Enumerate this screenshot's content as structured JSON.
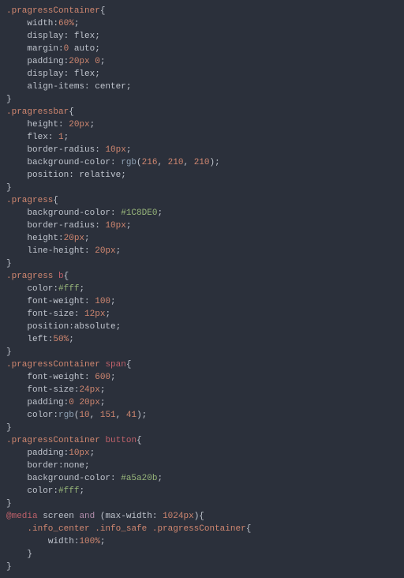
{
  "code": {
    "lines": [
      [
        {
          "t": ".pragressContainer",
          "c": "sel"
        },
        {
          "t": "{",
          "c": "punc"
        }
      ],
      [
        {
          "t": "    ",
          "c": ""
        },
        {
          "t": "width",
          "c": "prop"
        },
        {
          "t": ":",
          "c": "punc"
        },
        {
          "t": "60%",
          "c": "num"
        },
        {
          "t": ";",
          "c": "punc"
        }
      ],
      [
        {
          "t": "    ",
          "c": ""
        },
        {
          "t": "display",
          "c": "prop"
        },
        {
          "t": ": ",
          "c": "punc"
        },
        {
          "t": "flex",
          "c": "prop"
        },
        {
          "t": ";",
          "c": "punc"
        }
      ],
      [
        {
          "t": "    ",
          "c": ""
        },
        {
          "t": "margin",
          "c": "prop"
        },
        {
          "t": ":",
          "c": "punc"
        },
        {
          "t": "0",
          "c": "num"
        },
        {
          "t": " ",
          "c": ""
        },
        {
          "t": "auto",
          "c": "prop"
        },
        {
          "t": ";",
          "c": "punc"
        }
      ],
      [
        {
          "t": "    ",
          "c": ""
        },
        {
          "t": "padding",
          "c": "prop"
        },
        {
          "t": ":",
          "c": "punc"
        },
        {
          "t": "20px",
          "c": "num"
        },
        {
          "t": " ",
          "c": ""
        },
        {
          "t": "0",
          "c": "num"
        },
        {
          "t": ";",
          "c": "punc"
        }
      ],
      [
        {
          "t": "    ",
          "c": ""
        },
        {
          "t": "display",
          "c": "prop"
        },
        {
          "t": ": ",
          "c": "punc"
        },
        {
          "t": "flex",
          "c": "prop"
        },
        {
          "t": ";",
          "c": "punc"
        }
      ],
      [
        {
          "t": "    ",
          "c": ""
        },
        {
          "t": "align-items",
          "c": "prop"
        },
        {
          "t": ": ",
          "c": "punc"
        },
        {
          "t": "center",
          "c": "prop"
        },
        {
          "t": ";",
          "c": "punc"
        }
      ],
      [
        {
          "t": "}",
          "c": "punc"
        }
      ],
      [
        {
          "t": ".pragressbar",
          "c": "sel"
        },
        {
          "t": "{",
          "c": "punc"
        }
      ],
      [
        {
          "t": "    ",
          "c": ""
        },
        {
          "t": "height",
          "c": "prop"
        },
        {
          "t": ": ",
          "c": "punc"
        },
        {
          "t": "20px",
          "c": "num"
        },
        {
          "t": ";",
          "c": "punc"
        }
      ],
      [
        {
          "t": "    ",
          "c": ""
        },
        {
          "t": "flex",
          "c": "prop"
        },
        {
          "t": ": ",
          "c": "punc"
        },
        {
          "t": "1",
          "c": "num"
        },
        {
          "t": ";",
          "c": "punc"
        }
      ],
      [
        {
          "t": "    ",
          "c": ""
        },
        {
          "t": "border-radius",
          "c": "prop"
        },
        {
          "t": ": ",
          "c": "punc"
        },
        {
          "t": "10px",
          "c": "num"
        },
        {
          "t": ";",
          "c": "punc"
        }
      ],
      [
        {
          "t": "    ",
          "c": ""
        },
        {
          "t": "background-color",
          "c": "prop"
        },
        {
          "t": ": ",
          "c": "punc"
        },
        {
          "t": "rgb",
          "c": "fn"
        },
        {
          "t": "(",
          "c": "punc"
        },
        {
          "t": "216",
          "c": "num"
        },
        {
          "t": ", ",
          "c": "punc"
        },
        {
          "t": "210",
          "c": "num"
        },
        {
          "t": ", ",
          "c": "punc"
        },
        {
          "t": "210",
          "c": "num"
        },
        {
          "t": ");",
          "c": "punc"
        }
      ],
      [
        {
          "t": "    ",
          "c": ""
        },
        {
          "t": "position",
          "c": "prop"
        },
        {
          "t": ": ",
          "c": "punc"
        },
        {
          "t": "relative",
          "c": "prop"
        },
        {
          "t": ";",
          "c": "punc"
        }
      ],
      [
        {
          "t": "}",
          "c": "punc"
        }
      ],
      [
        {
          "t": ".pragress",
          "c": "sel"
        },
        {
          "t": "{",
          "c": "punc"
        }
      ],
      [
        {
          "t": "    ",
          "c": ""
        },
        {
          "t": "background-color",
          "c": "prop"
        },
        {
          "t": ": ",
          "c": "punc"
        },
        {
          "t": "#1C8DE0",
          "c": "hex"
        },
        {
          "t": ";",
          "c": "punc"
        }
      ],
      [
        {
          "t": "    ",
          "c": ""
        },
        {
          "t": "border-radius",
          "c": "prop"
        },
        {
          "t": ": ",
          "c": "punc"
        },
        {
          "t": "10px",
          "c": "num"
        },
        {
          "t": ";",
          "c": "punc"
        }
      ],
      [
        {
          "t": "    ",
          "c": ""
        },
        {
          "t": "height",
          "c": "prop"
        },
        {
          "t": ":",
          "c": "punc"
        },
        {
          "t": "20px",
          "c": "num"
        },
        {
          "t": ";",
          "c": "punc"
        }
      ],
      [
        {
          "t": "    ",
          "c": ""
        },
        {
          "t": "line-height",
          "c": "prop"
        },
        {
          "t": ": ",
          "c": "punc"
        },
        {
          "t": "20px",
          "c": "num"
        },
        {
          "t": ";",
          "c": "punc"
        }
      ],
      [
        {
          "t": "}",
          "c": "punc"
        }
      ],
      [
        {
          "t": ".pragress",
          "c": "sel"
        },
        {
          "t": " ",
          "c": ""
        },
        {
          "t": "b",
          "c": "tag"
        },
        {
          "t": "{",
          "c": "punc"
        }
      ],
      [
        {
          "t": "    ",
          "c": ""
        },
        {
          "t": "color",
          "c": "prop"
        },
        {
          "t": ":",
          "c": "punc"
        },
        {
          "t": "#fff",
          "c": "hex"
        },
        {
          "t": ";",
          "c": "punc"
        }
      ],
      [
        {
          "t": "    ",
          "c": ""
        },
        {
          "t": "font-weight",
          "c": "prop"
        },
        {
          "t": ": ",
          "c": "punc"
        },
        {
          "t": "100",
          "c": "num"
        },
        {
          "t": ";",
          "c": "punc"
        }
      ],
      [
        {
          "t": "    ",
          "c": ""
        },
        {
          "t": "font-size",
          "c": "prop"
        },
        {
          "t": ": ",
          "c": "punc"
        },
        {
          "t": "12px",
          "c": "num"
        },
        {
          "t": ";",
          "c": "punc"
        }
      ],
      [
        {
          "t": "    ",
          "c": ""
        },
        {
          "t": "position",
          "c": "prop"
        },
        {
          "t": ":",
          "c": "punc"
        },
        {
          "t": "absolute",
          "c": "prop"
        },
        {
          "t": ";",
          "c": "punc"
        }
      ],
      [
        {
          "t": "    ",
          "c": ""
        },
        {
          "t": "left",
          "c": "prop"
        },
        {
          "t": ":",
          "c": "punc"
        },
        {
          "t": "50%",
          "c": "num"
        },
        {
          "t": ";",
          "c": "punc"
        }
      ],
      [
        {
          "t": "}",
          "c": "punc"
        }
      ],
      [
        {
          "t": ".pragressContainer",
          "c": "sel"
        },
        {
          "t": " ",
          "c": ""
        },
        {
          "t": "span",
          "c": "tag"
        },
        {
          "t": "{",
          "c": "punc"
        }
      ],
      [
        {
          "t": "    ",
          "c": ""
        },
        {
          "t": "font-weight",
          "c": "prop"
        },
        {
          "t": ": ",
          "c": "punc"
        },
        {
          "t": "600",
          "c": "num"
        },
        {
          "t": ";",
          "c": "punc"
        }
      ],
      [
        {
          "t": "    ",
          "c": ""
        },
        {
          "t": "font-size",
          "c": "prop"
        },
        {
          "t": ":",
          "c": "punc"
        },
        {
          "t": "24px",
          "c": "num"
        },
        {
          "t": ";",
          "c": "punc"
        }
      ],
      [
        {
          "t": "    ",
          "c": ""
        },
        {
          "t": "padding",
          "c": "prop"
        },
        {
          "t": ":",
          "c": "punc"
        },
        {
          "t": "0",
          "c": "num"
        },
        {
          "t": " ",
          "c": ""
        },
        {
          "t": "20px",
          "c": "num"
        },
        {
          "t": ";",
          "c": "punc"
        }
      ],
      [
        {
          "t": "    ",
          "c": ""
        },
        {
          "t": "color",
          "c": "prop"
        },
        {
          "t": ":",
          "c": "punc"
        },
        {
          "t": "rgb",
          "c": "fn"
        },
        {
          "t": "(",
          "c": "punc"
        },
        {
          "t": "10",
          "c": "num"
        },
        {
          "t": ", ",
          "c": "punc"
        },
        {
          "t": "151",
          "c": "num"
        },
        {
          "t": ", ",
          "c": "punc"
        },
        {
          "t": "41",
          "c": "num"
        },
        {
          "t": ");",
          "c": "punc"
        }
      ],
      [
        {
          "t": "}",
          "c": "punc"
        }
      ],
      [
        {
          "t": ".pragressContainer",
          "c": "sel"
        },
        {
          "t": " ",
          "c": ""
        },
        {
          "t": "button",
          "c": "tag"
        },
        {
          "t": "{",
          "c": "punc"
        }
      ],
      [
        {
          "t": "    ",
          "c": ""
        },
        {
          "t": "padding",
          "c": "prop"
        },
        {
          "t": ":",
          "c": "punc"
        },
        {
          "t": "10px",
          "c": "num"
        },
        {
          "t": ";",
          "c": "punc"
        }
      ],
      [
        {
          "t": "    ",
          "c": ""
        },
        {
          "t": "border",
          "c": "prop"
        },
        {
          "t": ":",
          "c": "punc"
        },
        {
          "t": "none",
          "c": "prop"
        },
        {
          "t": ";",
          "c": "punc"
        }
      ],
      [
        {
          "t": "    ",
          "c": ""
        },
        {
          "t": "background-color",
          "c": "prop"
        },
        {
          "t": ": ",
          "c": "punc"
        },
        {
          "t": "#a5a20b",
          "c": "hex"
        },
        {
          "t": ";",
          "c": "punc"
        }
      ],
      [
        {
          "t": "    ",
          "c": ""
        },
        {
          "t": "color",
          "c": "prop"
        },
        {
          "t": ":",
          "c": "punc"
        },
        {
          "t": "#fff",
          "c": "hex"
        },
        {
          "t": ";",
          "c": "punc"
        }
      ],
      [
        {
          "t": "}",
          "c": "punc"
        }
      ],
      [
        {
          "t": "@",
          "c": "at"
        },
        {
          "t": "media",
          "c": "at"
        },
        {
          "t": " screen ",
          "c": "prop"
        },
        {
          "t": "and",
          "c": "kw"
        },
        {
          "t": " (",
          "c": "punc"
        },
        {
          "t": "max-width",
          "c": "prop"
        },
        {
          "t": ": ",
          "c": "punc"
        },
        {
          "t": "1024px",
          "c": "num"
        },
        {
          "t": "){",
          "c": "punc"
        }
      ],
      [
        {
          "t": "    ",
          "c": ""
        },
        {
          "t": ".info_center",
          "c": "sel"
        },
        {
          "t": " ",
          "c": ""
        },
        {
          "t": ".info_safe",
          "c": "sel"
        },
        {
          "t": " ",
          "c": ""
        },
        {
          "t": ".pragressContainer",
          "c": "sel"
        },
        {
          "t": "{",
          "c": "punc"
        }
      ],
      [
        {
          "t": "        ",
          "c": ""
        },
        {
          "t": "width",
          "c": "prop"
        },
        {
          "t": ":",
          "c": "punc"
        },
        {
          "t": "100%",
          "c": "num"
        },
        {
          "t": ";",
          "c": "punc"
        }
      ],
      [
        {
          "t": "    }",
          "c": "punc"
        }
      ],
      [
        {
          "t": "}",
          "c": "punc"
        }
      ]
    ]
  }
}
